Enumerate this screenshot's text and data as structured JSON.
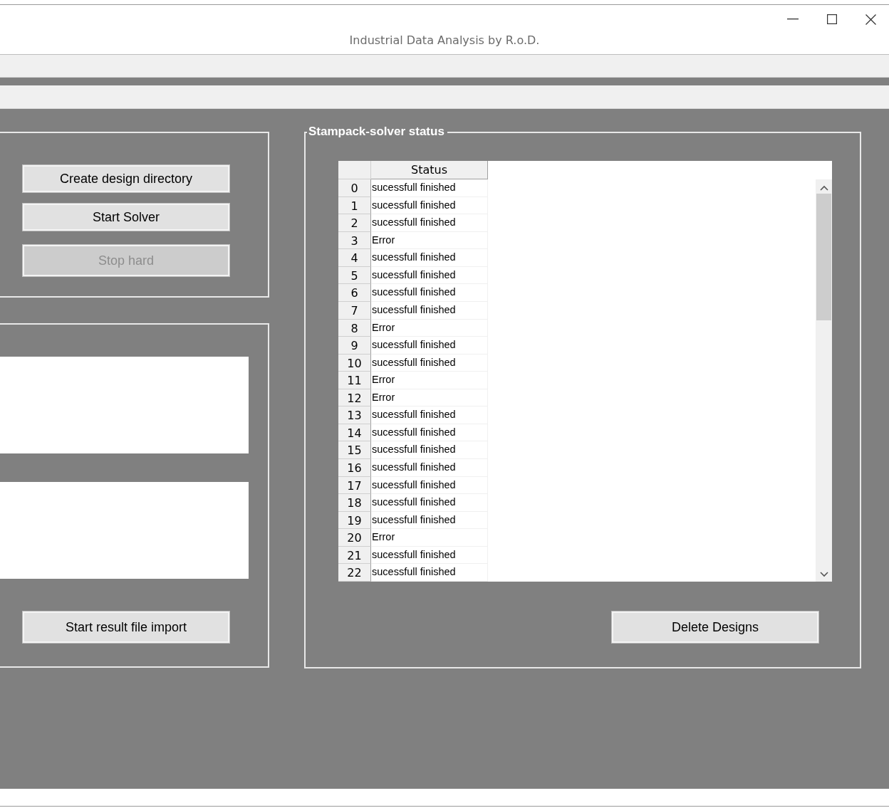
{
  "window": {
    "title": "Industrial Data Analysis by R.o.D."
  },
  "solver_panel": {
    "buttons": [
      {
        "label": "Create design directory",
        "disabled": false
      },
      {
        "label": "Start Solver",
        "disabled": false
      },
      {
        "label": "Stop hard",
        "disabled": true
      }
    ]
  },
  "import_panel": {
    "buttons": [
      {
        "label": "Start result file import",
        "disabled": false
      }
    ]
  },
  "status_panel": {
    "title": "Stampack-solver status",
    "table": {
      "columns": [
        "Status"
      ],
      "rows": [
        {
          "index": "0",
          "status": "sucessfull finished"
        },
        {
          "index": "1",
          "status": "sucessfull finished"
        },
        {
          "index": "2",
          "status": "sucessfull finished"
        },
        {
          "index": "3",
          "status": "Error"
        },
        {
          "index": "4",
          "status": "sucessfull finished"
        },
        {
          "index": "5",
          "status": "sucessfull finished"
        },
        {
          "index": "6",
          "status": "sucessfull finished"
        },
        {
          "index": "7",
          "status": "sucessfull finished"
        },
        {
          "index": "8",
          "status": "Error"
        },
        {
          "index": "9",
          "status": "sucessfull finished"
        },
        {
          "index": "10",
          "status": "sucessfull finished"
        },
        {
          "index": "11",
          "status": "Error"
        },
        {
          "index": "12",
          "status": "Error"
        },
        {
          "index": "13",
          "status": "sucessfull finished"
        },
        {
          "index": "14",
          "status": "sucessfull finished"
        },
        {
          "index": "15",
          "status": "sucessfull finished"
        },
        {
          "index": "16",
          "status": "sucessfull finished"
        },
        {
          "index": "17",
          "status": "sucessfull finished"
        },
        {
          "index": "18",
          "status": "sucessfull finished"
        },
        {
          "index": "19",
          "status": "sucessfull finished"
        },
        {
          "index": "20",
          "status": "Error"
        },
        {
          "index": "21",
          "status": "sucessfull finished"
        },
        {
          "index": "22",
          "status": "sucessfull finished"
        }
      ]
    },
    "buttons": [
      {
        "label": "Delete Designs",
        "disabled": false
      }
    ]
  }
}
